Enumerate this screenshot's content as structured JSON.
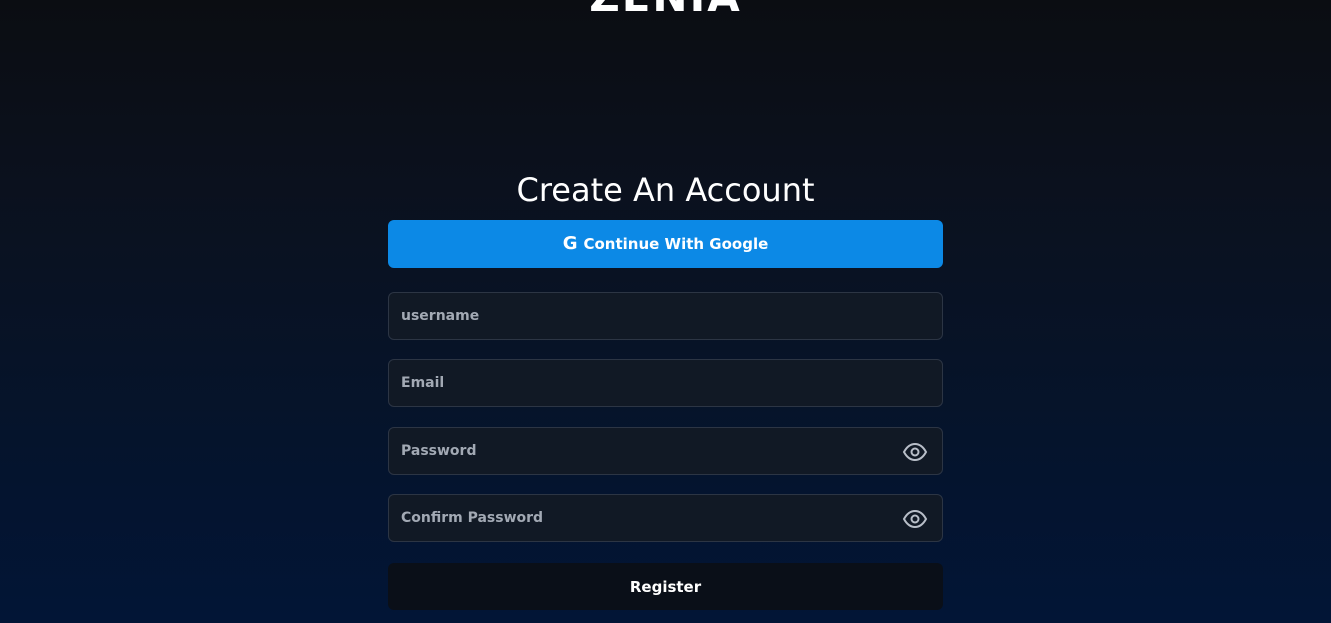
{
  "brand": {
    "logo_text": "ZENIA"
  },
  "signup": {
    "title": "Create An Account",
    "google_button_label": "Continue With Google",
    "google_icon_glyph": "G",
    "fields": {
      "username": {
        "placeholder": "username",
        "value": ""
      },
      "email": {
        "placeholder": "Email",
        "value": ""
      },
      "password": {
        "placeholder": "Password",
        "value": ""
      },
      "confirm_password": {
        "placeholder": "Confirm Password",
        "value": ""
      }
    },
    "register_label": "Register"
  },
  "icons": {
    "google": "google-icon",
    "password_toggle": "eye-icon",
    "confirm_password_toggle": "eye-icon"
  },
  "colors": {
    "google_button": "#0c89e6",
    "register_button": "#0a0f18",
    "field_background": "#111925",
    "field_border": "#2c3544",
    "placeholder": "#a2a9b4"
  }
}
